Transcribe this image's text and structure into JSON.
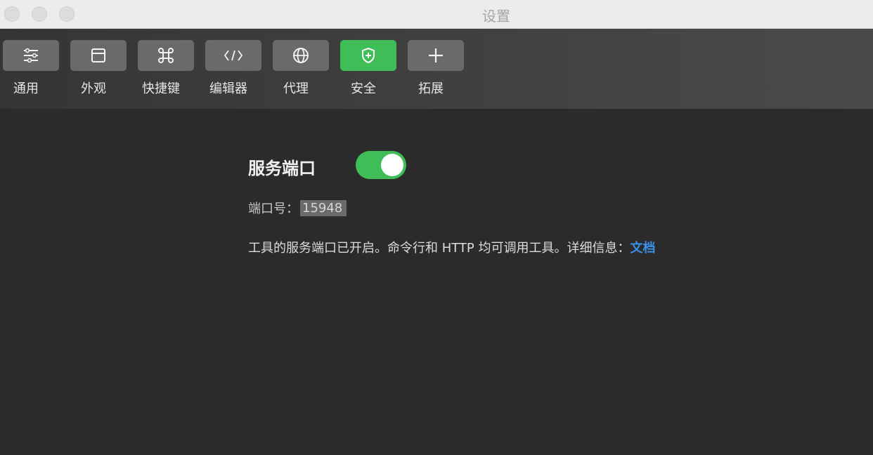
{
  "window": {
    "title": "设置"
  },
  "toolbar": {
    "items": [
      {
        "label": "通用",
        "icon": "sliders-icon"
      },
      {
        "label": "外观",
        "icon": "window-icon"
      },
      {
        "label": "快捷键",
        "icon": "command-key-icon"
      },
      {
        "label": "编辑器",
        "icon": "code-icon"
      },
      {
        "label": "代理",
        "icon": "globe-icon"
      },
      {
        "label": "安全",
        "icon": "shield-icon",
        "active": true
      },
      {
        "label": "拓展",
        "icon": "plus-icon"
      }
    ]
  },
  "security": {
    "section_title": "服务端口",
    "toggle_on": true,
    "port_label": "端口号：",
    "port_value": "15948",
    "description": "工具的服务端口已开启。命令行和 HTTP 均可调用工具。详细信息：",
    "doc_link": "文档"
  },
  "colors": {
    "accent_green": "#3fbe58",
    "link_blue": "#3a8fe8",
    "background": "#2b2b2b"
  }
}
